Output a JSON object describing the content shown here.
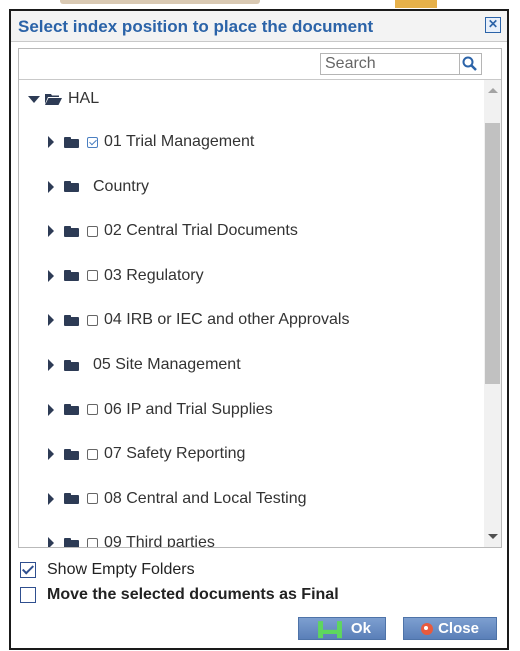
{
  "dialog": {
    "title": "Select index position to place the document",
    "close_glyph": "✕"
  },
  "search": {
    "placeholder": "Search",
    "value": ""
  },
  "tree": {
    "root": {
      "label": "HAL",
      "icon": "folder-open-icon",
      "expanded": true
    },
    "items": [
      {
        "label": "01 Trial Management",
        "checkbox": true,
        "checked": true
      },
      {
        "label": "Country",
        "checkbox": false,
        "checked": false
      },
      {
        "label": "02 Central Trial Documents",
        "checkbox": true,
        "checked": false
      },
      {
        "label": "03 Regulatory",
        "checkbox": true,
        "checked": false
      },
      {
        "label": "04 IRB or IEC and other Approvals",
        "checkbox": true,
        "checked": false
      },
      {
        "label": "05 Site Management",
        "checkbox": false,
        "checked": false
      },
      {
        "label": "06 IP and Trial Supplies",
        "checkbox": true,
        "checked": false
      },
      {
        "label": "07 Safety Reporting",
        "checkbox": true,
        "checked": false
      },
      {
        "label": "08 Central and Local Testing",
        "checkbox": true,
        "checked": false
      },
      {
        "label": "09 Third parties",
        "checkbox": true,
        "checked": false
      }
    ]
  },
  "options": {
    "show_empty_folders": {
      "label": "Show Empty Folders",
      "checked": true
    },
    "move_as_final": {
      "label": "Move the selected documents as Final",
      "checked": false
    }
  },
  "buttons": {
    "ok_label": "Ok",
    "close_label": "Close"
  },
  "colors": {
    "title": "#2b63a8",
    "button": "#6a8fc6",
    "folder": "#2d3b55"
  }
}
